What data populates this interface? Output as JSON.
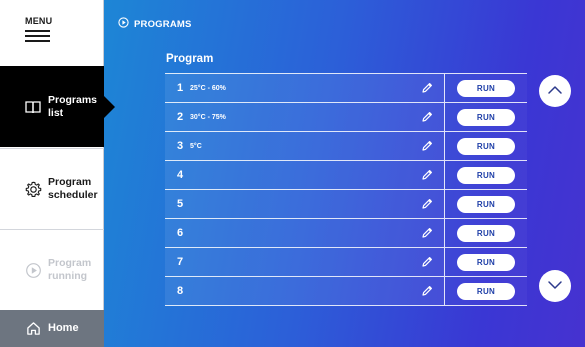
{
  "sidebar": {
    "menu_label": "MENU",
    "items": [
      {
        "label": "Programs\nlist",
        "icon": "book-icon",
        "state": "active"
      },
      {
        "label": "Program\nscheduler",
        "icon": "gear-icon",
        "state": "normal"
      },
      {
        "label": "Program\nrunning",
        "icon": "play-circle-icon",
        "state": "disabled"
      }
    ],
    "home_label": "Home",
    "home_icon": "home-icon"
  },
  "header": {
    "breadcrumb": "PROGRAMS",
    "breadcrumb_icon": "play-circle-icon"
  },
  "table": {
    "column_header": "Program",
    "run_label": "RUN",
    "rows": [
      {
        "number": "1",
        "description": "25°C - 60%"
      },
      {
        "number": "2",
        "description": "30°C - 75%"
      },
      {
        "number": "3",
        "description": "5°C"
      },
      {
        "number": "4",
        "description": ""
      },
      {
        "number": "5",
        "description": ""
      },
      {
        "number": "6",
        "description": ""
      },
      {
        "number": "7",
        "description": ""
      },
      {
        "number": "8",
        "description": ""
      }
    ]
  },
  "colors": {
    "gradient_start": "#1d86d6",
    "gradient_end": "#4632d0",
    "active_nav": "#000000",
    "home_bg": "#6d7580",
    "disabled_text": "#c3c6cc"
  }
}
